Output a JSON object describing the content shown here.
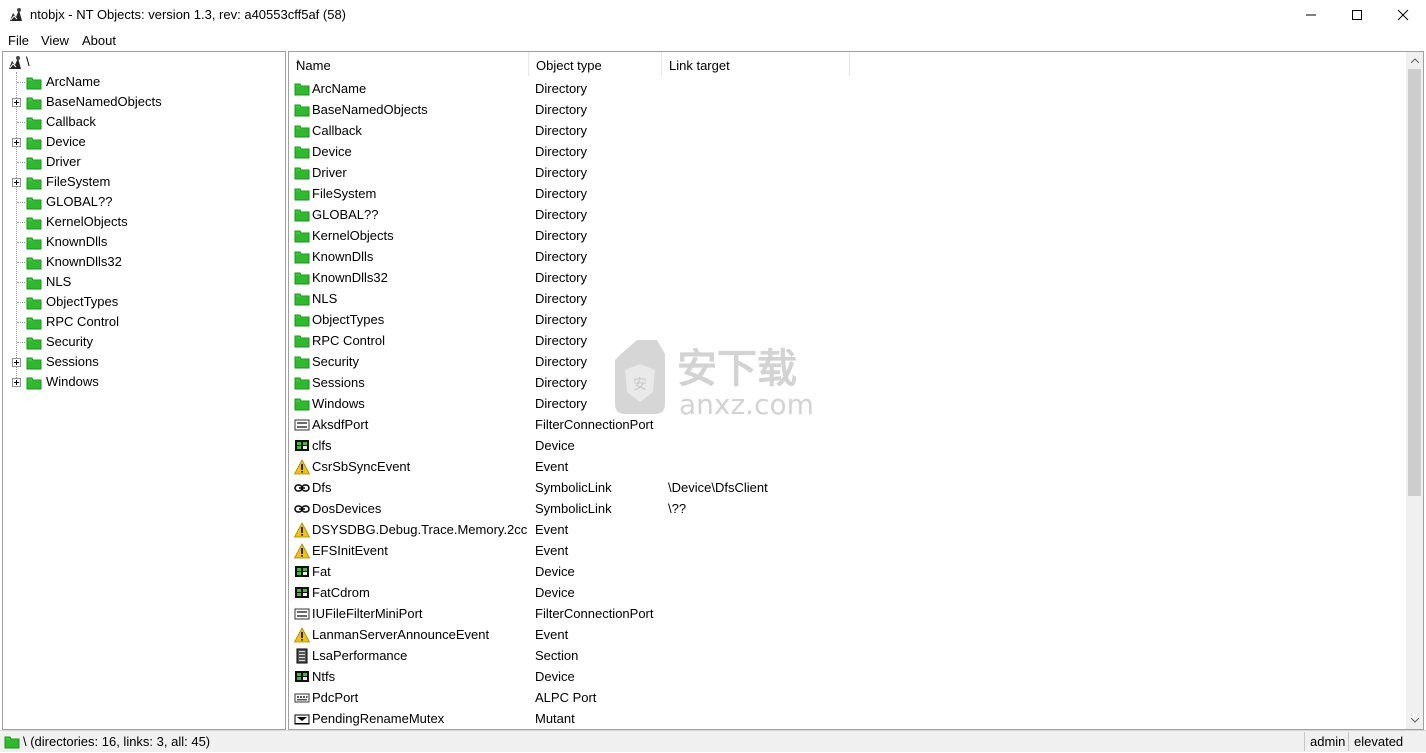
{
  "window": {
    "title": "ntobjx - NT Objects: version 1.3, rev: a40553cff5af (58)",
    "minimize_glyph": "–",
    "maximize_glyph": "☐",
    "close_glyph": "✕"
  },
  "menu": [
    "File",
    "View",
    "About"
  ],
  "tree": {
    "root_label": "\\",
    "items": [
      {
        "label": "ArcName",
        "expandable": false
      },
      {
        "label": "BaseNamedObjects",
        "expandable": true
      },
      {
        "label": "Callback",
        "expandable": false
      },
      {
        "label": "Device",
        "expandable": true
      },
      {
        "label": "Driver",
        "expandable": false
      },
      {
        "label": "FileSystem",
        "expandable": true
      },
      {
        "label": "GLOBAL??",
        "expandable": false
      },
      {
        "label": "KernelObjects",
        "expandable": false
      },
      {
        "label": "KnownDlls",
        "expandable": false
      },
      {
        "label": "KnownDlls32",
        "expandable": false
      },
      {
        "label": "NLS",
        "expandable": false
      },
      {
        "label": "ObjectTypes",
        "expandable": false
      },
      {
        "label": "RPC Control",
        "expandable": false
      },
      {
        "label": "Security",
        "expandable": false
      },
      {
        "label": "Sessions",
        "expandable": true
      },
      {
        "label": "Windows",
        "expandable": true
      }
    ]
  },
  "list": {
    "columns": [
      "Name",
      "Object type",
      "Link target"
    ],
    "sort_indicator": "^",
    "rows": [
      {
        "icon": "folder-icon",
        "name": "ArcName",
        "type": "Directory",
        "target": ""
      },
      {
        "icon": "folder-icon",
        "name": "BaseNamedObjects",
        "type": "Directory",
        "target": ""
      },
      {
        "icon": "folder-icon",
        "name": "Callback",
        "type": "Directory",
        "target": ""
      },
      {
        "icon": "folder-icon",
        "name": "Device",
        "type": "Directory",
        "target": ""
      },
      {
        "icon": "folder-icon",
        "name": "Driver",
        "type": "Directory",
        "target": ""
      },
      {
        "icon": "folder-icon",
        "name": "FileSystem",
        "type": "Directory",
        "target": ""
      },
      {
        "icon": "folder-icon",
        "name": "GLOBAL??",
        "type": "Directory",
        "target": ""
      },
      {
        "icon": "folder-icon",
        "name": "KernelObjects",
        "type": "Directory",
        "target": ""
      },
      {
        "icon": "folder-icon",
        "name": "KnownDlls",
        "type": "Directory",
        "target": ""
      },
      {
        "icon": "folder-icon",
        "name": "KnownDlls32",
        "type": "Directory",
        "target": ""
      },
      {
        "icon": "folder-icon",
        "name": "NLS",
        "type": "Directory",
        "target": ""
      },
      {
        "icon": "folder-icon",
        "name": "ObjectTypes",
        "type": "Directory",
        "target": ""
      },
      {
        "icon": "folder-icon",
        "name": "RPC Control",
        "type": "Directory",
        "target": ""
      },
      {
        "icon": "folder-icon",
        "name": "Security",
        "type": "Directory",
        "target": ""
      },
      {
        "icon": "folder-icon",
        "name": "Sessions",
        "type": "Directory",
        "target": ""
      },
      {
        "icon": "folder-icon",
        "name": "Windows",
        "type": "Directory",
        "target": ""
      },
      {
        "icon": "port-icon",
        "name": "AksdfPort",
        "type": "FilterConnectionPort",
        "target": ""
      },
      {
        "icon": "device-icon",
        "name": "clfs",
        "type": "Device",
        "target": ""
      },
      {
        "icon": "event-icon",
        "name": "CsrSbSyncEvent",
        "type": "Event",
        "target": ""
      },
      {
        "icon": "link-icon",
        "name": "Dfs",
        "type": "SymbolicLink",
        "target": "\\Device\\DfsClient"
      },
      {
        "icon": "link-icon",
        "name": "DosDevices",
        "type": "SymbolicLink",
        "target": "\\??"
      },
      {
        "icon": "event-icon",
        "name": "DSYSDBG.Debug.Trace.Memory.2cc",
        "type": "Event",
        "target": ""
      },
      {
        "icon": "event-icon",
        "name": "EFSInitEvent",
        "type": "Event",
        "target": ""
      },
      {
        "icon": "device-icon",
        "name": "Fat",
        "type": "Device",
        "target": ""
      },
      {
        "icon": "device-icon",
        "name": "FatCdrom",
        "type": "Device",
        "target": ""
      },
      {
        "icon": "port-icon",
        "name": "IUFileFilterMiniPort",
        "type": "FilterConnectionPort",
        "target": ""
      },
      {
        "icon": "event-icon",
        "name": "LanmanServerAnnounceEvent",
        "type": "Event",
        "target": ""
      },
      {
        "icon": "section-icon",
        "name": "LsaPerformance",
        "type": "Section",
        "target": ""
      },
      {
        "icon": "device-icon",
        "name": "Ntfs",
        "type": "Device",
        "target": ""
      },
      {
        "icon": "alpc-icon",
        "name": "PdcPort",
        "type": "ALPC Port",
        "target": ""
      },
      {
        "icon": "mutant-icon",
        "name": "PendingRenameMutex",
        "type": "Mutant",
        "target": ""
      }
    ]
  },
  "status": {
    "text": "\\ (directories: 16, links: 3, all: 45)",
    "user": "admin",
    "elevation": "elevated"
  },
  "watermark": {
    "cn_text": "安下载",
    "domain_text": "anxz.com",
    "badge_char": "安"
  },
  "colors": {
    "folder_green": "#33cc33",
    "folder_dark": "#1f8f1f",
    "border": "#a0a0a0",
    "status_bg": "#f0f0f0"
  }
}
